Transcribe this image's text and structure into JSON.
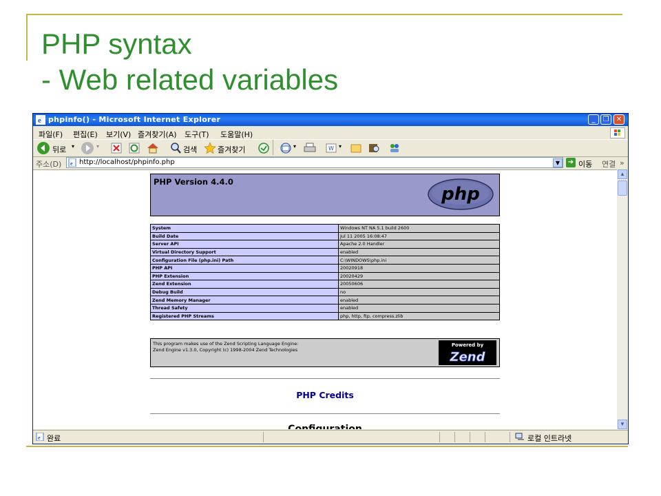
{
  "slide": {
    "title_line1": "PHP syntax",
    "title_line2": "- Web related variables"
  },
  "browser": {
    "window_title": "phpinfo() - Microsoft Internet Explorer",
    "menu": [
      "파일(F)",
      "편집(E)",
      "보기(V)",
      "즐겨찾기(A)",
      "도구(T)",
      "도움말(H)"
    ],
    "toolbar": {
      "back_label": "뒤로",
      "search_label": "검색",
      "favorites_label": "즐겨찾기"
    },
    "address": {
      "label": "주소(D)",
      "url": "http://localhost/phpinfo.php",
      "go_label": "이동",
      "links_label": "연결",
      "chevron": "»"
    },
    "status": {
      "text": "완료",
      "zone": "로컬 인트라넷"
    },
    "icons": [
      "ie-icon",
      "back-icon",
      "forward-icon",
      "stop-icon",
      "refresh-icon",
      "home-icon",
      "search-icon",
      "favorites-star-icon",
      "media-icon",
      "mail-icon",
      "print-icon",
      "edit-icon",
      "folder-icon",
      "research-icon",
      "messenger-icon",
      "go-arrow-icon",
      "page-icon"
    ]
  },
  "phpinfo": {
    "version": "PHP Version 4.4.0",
    "logo_text": "php",
    "rows": [
      {
        "key": "System",
        "value": "Windows NT NA 5.1 build 2600"
      },
      {
        "key": "Build Date",
        "value": "Jul 11 2005 16:08:47"
      },
      {
        "key": "Server API",
        "value": "Apache 2.0 Handler"
      },
      {
        "key": "Virtual Directory Support",
        "value": "enabled"
      },
      {
        "key": "Configuration File (php.ini) Path",
        "value": "C:\\WINDOWS\\php.ini"
      },
      {
        "key": "PHP API",
        "value": "20020918"
      },
      {
        "key": "PHP Extension",
        "value": "20020429"
      },
      {
        "key": "Zend Extension",
        "value": "20050606"
      },
      {
        "key": "Debug Build",
        "value": "no"
      },
      {
        "key": "Zend Memory Manager",
        "value": "enabled"
      },
      {
        "key": "Thread Safety",
        "value": "enabled"
      },
      {
        "key": "Registered PHP Streams",
        "value": "php, http, ftp, compress.zlib"
      }
    ],
    "zend_line1": "This program makes use of the Zend Scripting Language Engine:",
    "zend_line2": "Zend Engine v1.3.0, Copyright (c) 1998-2004 Zend Technologies",
    "zend_badge_top": "Powered by",
    "zend_badge_word": "Zend",
    "credits_link": "PHP Credits",
    "config_heading": "Configuration"
  },
  "colors": {
    "slide_title": "#2f8f2f",
    "slide_rule": "#c8b24a",
    "php_header": "#9999cc",
    "php_key_cell": "#ccccff",
    "php_value_cell": "#cccccc"
  }
}
